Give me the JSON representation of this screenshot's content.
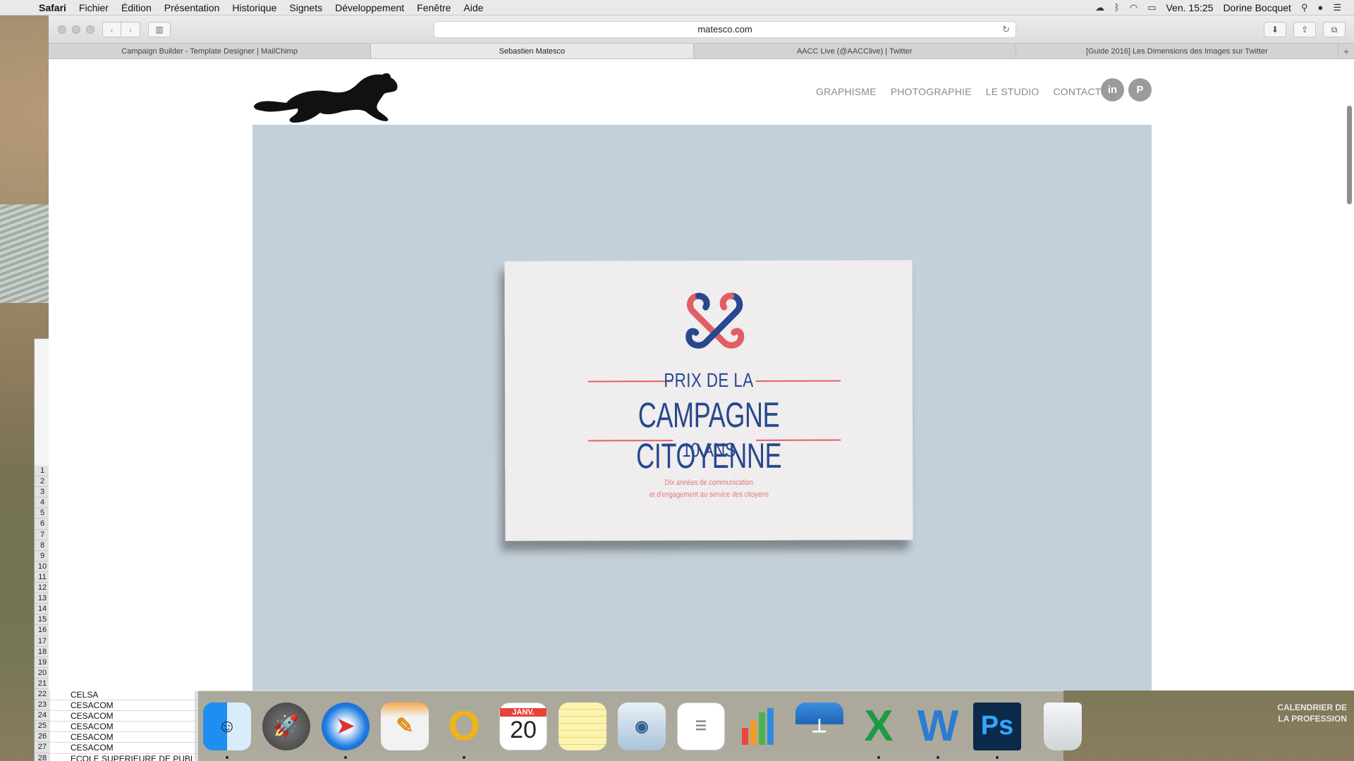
{
  "menubar": {
    "app": "Safari",
    "items": [
      "Fichier",
      "Édition",
      "Présentation",
      "Historique",
      "Signets",
      "Développement",
      "Fenêtre",
      "Aide"
    ],
    "clock": "Ven. 15:25",
    "user": "Dorine Bocquet"
  },
  "browser": {
    "url": "matesco.com",
    "tabs": [
      {
        "label": "Campaign Builder - Template Designer | MailChimp"
      },
      {
        "label": "Sebastien Matesco"
      },
      {
        "label": "AACC Live (@AACClive) | Twitter"
      },
      {
        "label": "[Guide 2016] Les Dimensions des Images sur Twitter"
      }
    ],
    "new_tab": "+"
  },
  "site": {
    "nav": [
      "GRAPHISME",
      "PHOTOGRAPHIE",
      "LE STUDIO",
      "CONTACT"
    ],
    "social": [
      "in",
      "P"
    ],
    "card": {
      "line1": "PRIX DE LA",
      "line2": "CAMPAGNE CITOYENNE",
      "line3": "10 ANS",
      "sub1": "Dix années de communication",
      "sub2": "et d'engagement au service des citoyens"
    },
    "colors": {
      "hero_bg": "#c4d0d9",
      "brand_blue": "#27488f",
      "brand_red": "#e25e65"
    }
  },
  "spreadsheet": {
    "row_numbers": [
      "1",
      "2",
      "3",
      "4",
      "5",
      "6",
      "7",
      "8",
      "9",
      "10",
      "11",
      "12",
      "13",
      "14",
      "15",
      "16",
      "17",
      "18",
      "19",
      "20",
      "21",
      "22",
      "23",
      "24",
      "25",
      "26",
      "27",
      "28"
    ],
    "cells": [
      "CELSA",
      "CESACOM",
      "CESACOM",
      "CESACOM",
      "CESACOM",
      "CESACOM",
      "ECOLE SUPERIEURE DE PUBL"
    ]
  },
  "dock": {
    "apps": [
      {
        "name": "Finder",
        "icon": "finder-icon"
      },
      {
        "name": "Launchpad",
        "icon": "rocket-icon"
      },
      {
        "name": "Safari",
        "icon": "compass-icon"
      },
      {
        "name": "Pages",
        "icon": "pages-icon"
      },
      {
        "name": "Outlook",
        "icon": "outlook-icon"
      },
      {
        "name": "Calendrier",
        "icon": "calendar-icon",
        "month": "JANV.",
        "day": "20"
      },
      {
        "name": "Notes",
        "icon": "notes-icon"
      },
      {
        "name": "Aperçu",
        "icon": "preview-icon"
      },
      {
        "name": "Rappels",
        "icon": "reminders-icon"
      },
      {
        "name": "Numbers",
        "icon": "numbers-icon"
      },
      {
        "name": "Keynote",
        "icon": "keynote-icon"
      },
      {
        "name": "Excel",
        "icon": "excel-icon",
        "letter": "X"
      },
      {
        "name": "Word",
        "icon": "word-icon",
        "letter": "W"
      },
      {
        "name": "Photoshop",
        "icon": "photoshop-icon",
        "letter": "Ps"
      },
      {
        "name": "Corbeille",
        "icon": "trash-icon"
      }
    ]
  },
  "desktop_widget": {
    "line1": "CALENDRIER DE",
    "line2": "LA PROFESSION"
  }
}
